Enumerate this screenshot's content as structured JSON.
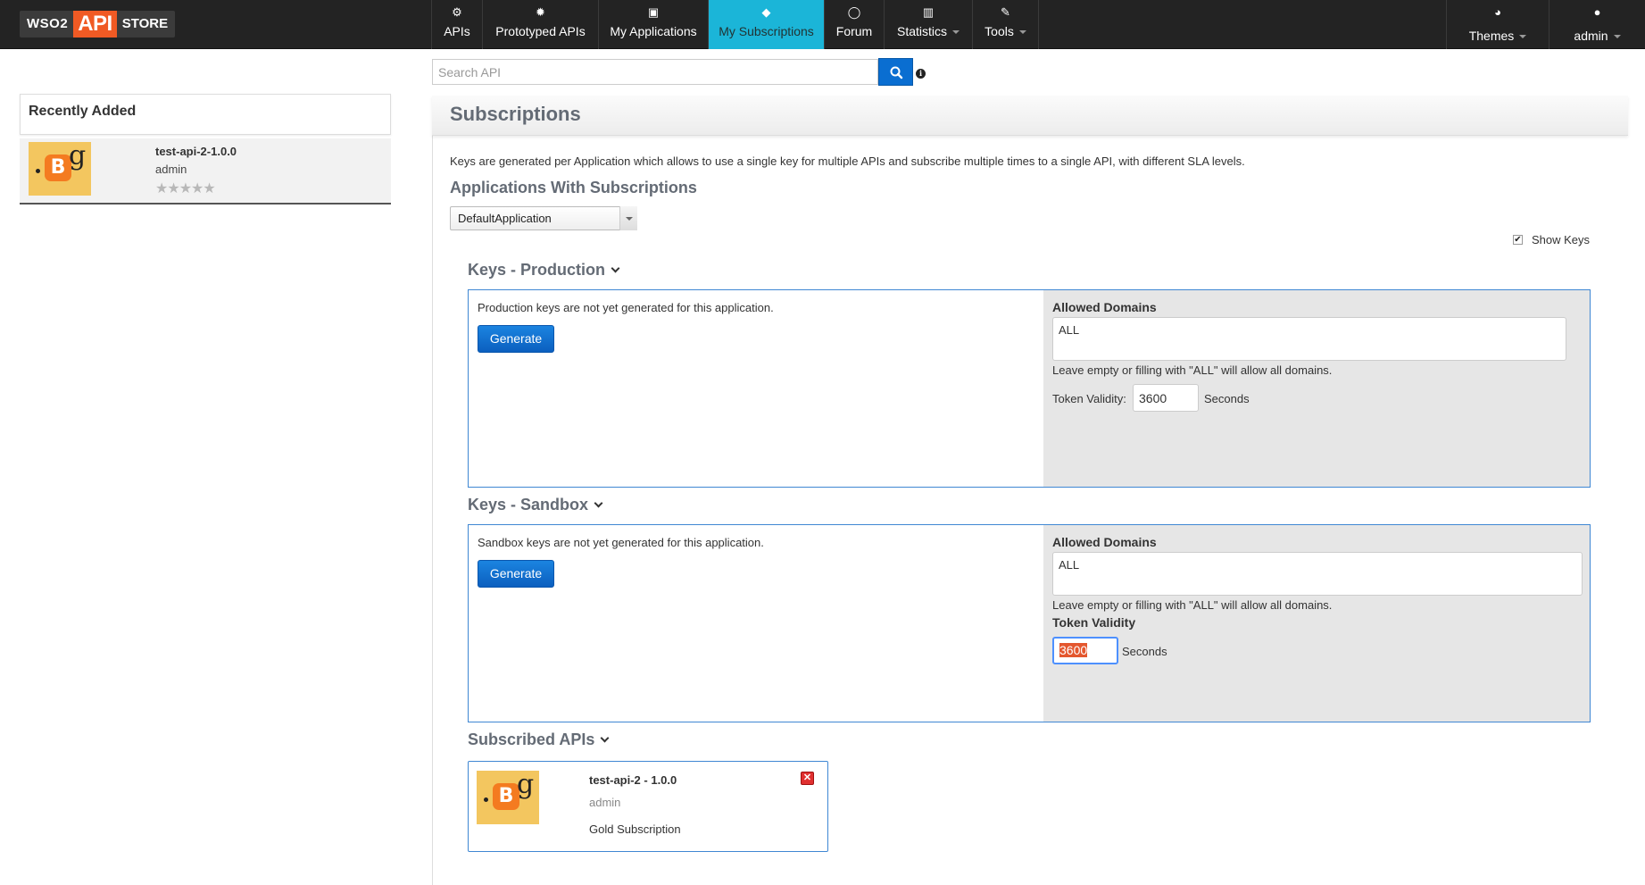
{
  "header": {
    "logo": {
      "wso2": "WSO2",
      "api": "API",
      "store": "STORE"
    },
    "nav": [
      {
        "label": "APIs",
        "icon": "cogs-icon"
      },
      {
        "label": "Prototyped APIs",
        "icon": "cog-icon"
      },
      {
        "label": "My Applications",
        "icon": "briefcase-icon"
      },
      {
        "label": "My Subscriptions",
        "icon": "tags-icon",
        "active": true
      },
      {
        "label": "Forum",
        "icon": "comment-icon"
      },
      {
        "label": "Statistics",
        "icon": "bar-chart-icon",
        "dropdown": true
      },
      {
        "label": "Tools",
        "icon": "wrench-icon",
        "dropdown": true
      }
    ],
    "themes_label": "Themes",
    "user_label": "admin",
    "active_color": "#1bb5d8"
  },
  "search": {
    "placeholder": "Search API",
    "value": ""
  },
  "sidebar": {
    "title": "Recently Added",
    "items": [
      {
        "name": "test-api-2-1.0.0",
        "owner": "admin",
        "rating": 0,
        "stars": "★★★★★"
      }
    ]
  },
  "main": {
    "title": "Subscriptions",
    "intro": "Keys are generated per Application which allows to use a single key for multiple APIs and subscribe multiple times to a single API, with different SLA levels.",
    "apps_heading": "Applications With Subscriptions",
    "selected_application": "DefaultApplication",
    "show_keys_label": "Show Keys",
    "show_keys_checked": true,
    "production": {
      "title": "Keys - Production",
      "message": "Production keys are not yet generated for this application.",
      "generate_label": "Generate",
      "allowed_domains_label": "Allowed Domains",
      "allowed_domains_value": "ALL",
      "domains_help": "Leave empty or filling with \"ALL\" will allow all domains.",
      "token_validity_label": "Token Validity:",
      "token_validity_value": "3600",
      "seconds_label": "Seconds"
    },
    "sandbox": {
      "title": "Keys - Sandbox",
      "message": "Sandbox keys are not yet generated for this application.",
      "generate_label": "Generate",
      "allowed_domains_label": "Allowed Domains",
      "allowed_domains_value": "ALL",
      "domains_help": "Leave empty or filling with \"ALL\" will allow all domains.",
      "token_validity_label": "Token Validity",
      "token_validity_value": "3600",
      "seconds_label": "Seconds"
    },
    "subscribed": {
      "title": "Subscribed APIs",
      "items": [
        {
          "name": "test-api-2 - 1.0.0",
          "owner": "admin",
          "tier": "Gold Subscription"
        }
      ]
    }
  }
}
